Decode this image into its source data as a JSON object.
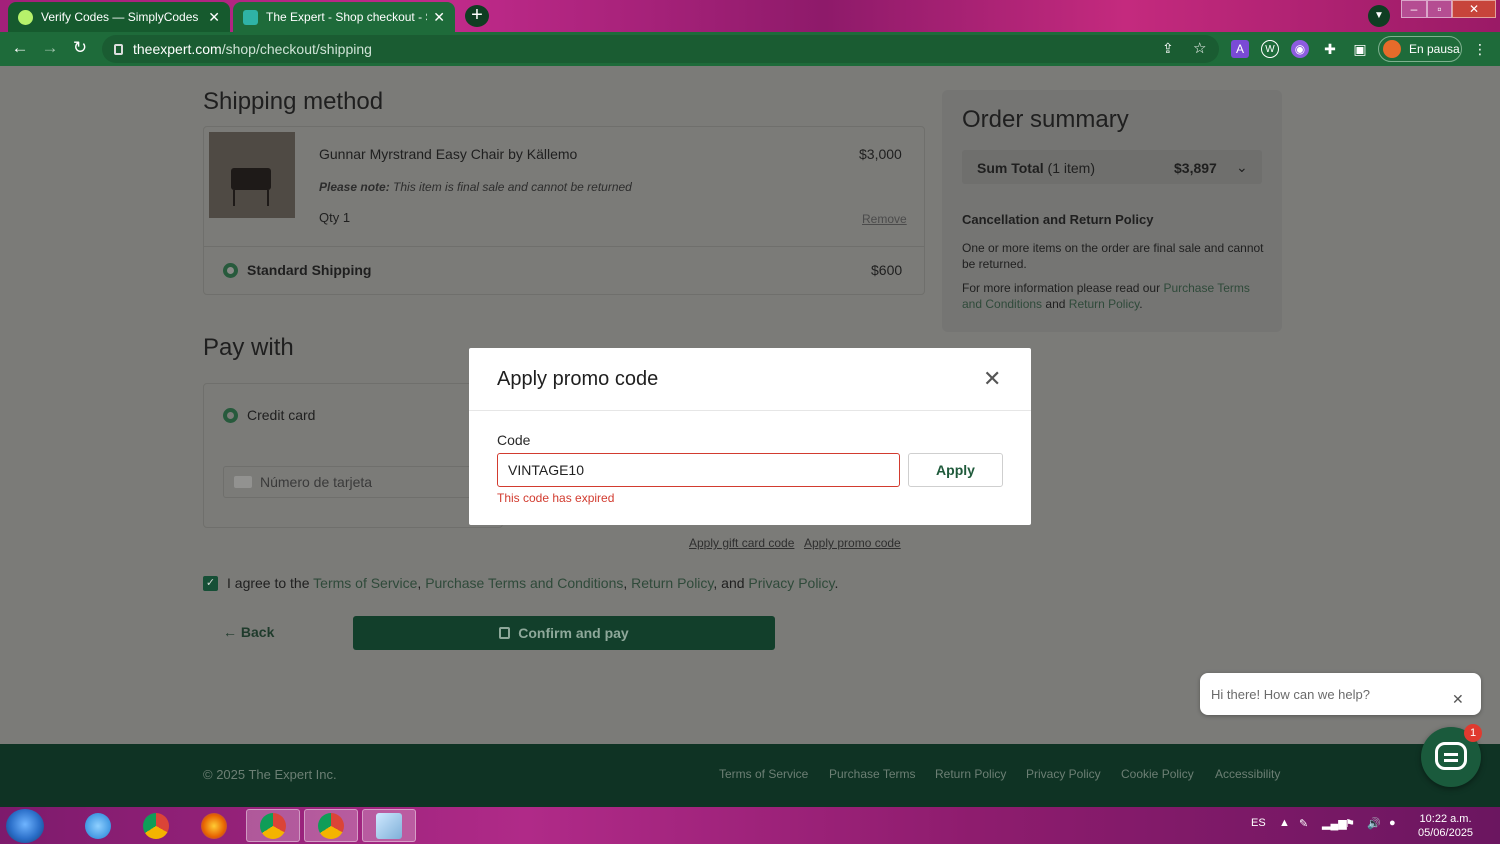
{
  "browser": {
    "tabs": [
      {
        "title": "Verify Codes — SimplyCodes",
        "close": "✕"
      },
      {
        "title": "The Expert - Shop checkout - Shipping",
        "close": "✕"
      }
    ],
    "new_tab": "+",
    "url_domain": "theexpert.com",
    "url_path": "/shop/checkout/shipping",
    "profile_label": "En pausa"
  },
  "shipping": {
    "heading": "Shipping method",
    "item_name": "Gunnar Myrstrand Easy Chair by Källemo",
    "item_price": "$3,000",
    "note_prefix": "Please note:",
    "note_text": "This item is final sale and cannot be returned",
    "qty": "Qty 1",
    "remove": "Remove",
    "method_label": "Standard Shipping",
    "method_price": "$600"
  },
  "payment": {
    "heading": "Pay with",
    "option": "Credit card",
    "card_placeholder": "Número de tarjeta",
    "gift_link": "Apply gift card code",
    "promo_link": "Apply promo code"
  },
  "agreement": {
    "prefix": "I agree to the",
    "terms": "Terms of Service",
    "purchase": "Purchase Terms and Conditions",
    "return": "Return Policy",
    "and": "and",
    "privacy": "Privacy Policy"
  },
  "actions": {
    "back": "Back",
    "confirm": "Confirm and pay"
  },
  "summary": {
    "heading": "Order summary",
    "sum_label": "Sum Total",
    "sum_count": "(1 item)",
    "sum_value": "$3,897",
    "policy_title": "Cancellation and Return Policy",
    "policy_text": "One or more items on the order are final sale and cannot be returned.",
    "more_prefix": "For more information please read our",
    "more_link1": "Purchase Terms and Conditions",
    "more_and": "and",
    "more_link2": "Return Policy"
  },
  "modal": {
    "title": "Apply promo code",
    "code_label": "Code",
    "code_value": "VINTAGE10",
    "apply": "Apply",
    "error": "This code has expired"
  },
  "footer": {
    "copyright": "© 2025 The Expert Inc.",
    "links": [
      "Terms of Service",
      "Purchase Terms",
      "Return Policy",
      "Privacy Policy",
      "Cookie Policy",
      "Accessibility"
    ]
  },
  "chat": {
    "greeting": "Hi there! How can we help?",
    "badge": "1"
  },
  "taskbar": {
    "lang": "ES",
    "time": "10:22 a.m.",
    "date": "05/06/2025"
  }
}
